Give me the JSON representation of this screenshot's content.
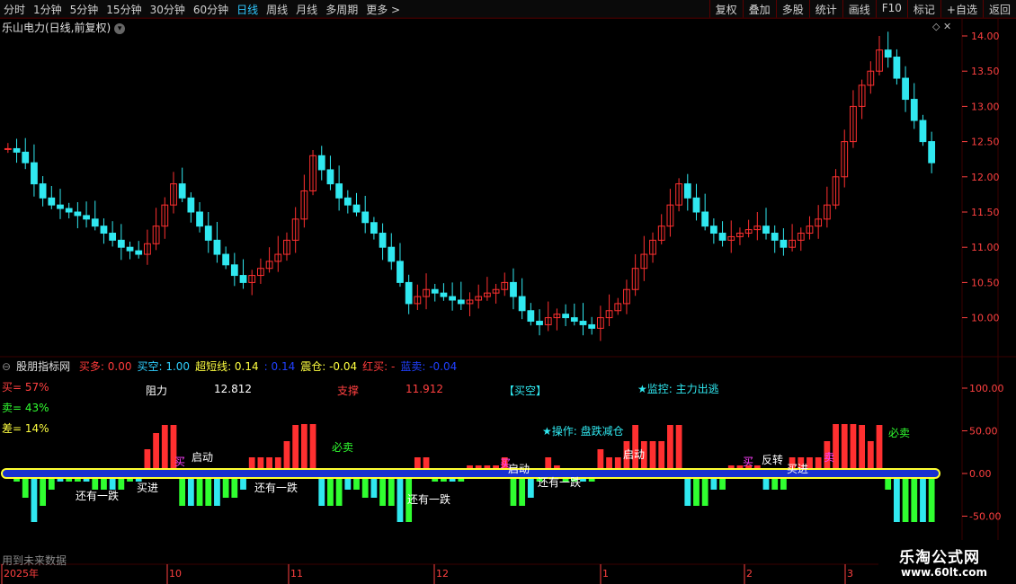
{
  "toolbar": {
    "periods": [
      "分时",
      "1分钟",
      "5分钟",
      "15分钟",
      "30分钟",
      "60分钟",
      "日线",
      "周线",
      "月线",
      "多周期",
      "更多 >"
    ],
    "active_period": "日线",
    "actions": [
      "复权",
      "叠加",
      "多股",
      "统计",
      "画线",
      "F10",
      "标记",
      "+自选",
      "返回"
    ]
  },
  "stock": {
    "title": "乐山电力(日线,前复权)"
  },
  "price_axis": {
    "ticks": [
      "14.00",
      "13.50",
      "13.00",
      "12.50",
      "12.00",
      "11.50",
      "11.00",
      "10.50",
      "10.00"
    ]
  },
  "indicator": {
    "name": "股朋指标网",
    "fields": [
      {
        "label": "买多: 0.00",
        "color": "#ff3b3b"
      },
      {
        "label": "买空: 1.00",
        "color": "#30d0ff"
      },
      {
        "label": "超短线: 0.14",
        "color": "#ffff40"
      },
      {
        "label": ": 0.14",
        "color": "#2040ff"
      },
      {
        "label": "震仓: -0.04",
        "color": "#ffff40"
      },
      {
        "label": "红买: -",
        "color": "#ff3b3b"
      },
      {
        "label": "蓝卖: -0.04",
        "color": "#2040ff"
      }
    ],
    "axis_ticks": [
      "100.00",
      "50.00",
      "0.00",
      "-50.00"
    ],
    "stats": {
      "buy": "买= 57%",
      "sell": "卖= 43%",
      "diff": "差= 14%"
    },
    "resistance_label": "阻力",
    "resistance_value": "12.812",
    "support_label": "支撑",
    "support_value": "11.912",
    "status": "【买空】",
    "monitor": "★监控: 主力出逃",
    "operation": "★操作: 盘跌减仓",
    "annotations": [
      "启动",
      "启动",
      "启动",
      "还有一跌",
      "还有一跌",
      "还有一跌",
      "还有一跌",
      "必卖",
      "必卖",
      "反转",
      "买",
      "买",
      "卖",
      "买",
      "买进",
      "买进"
    ],
    "footer_note": "用到未来数据"
  },
  "time_axis": {
    "labels": [
      "2025年",
      "10",
      "11",
      "12",
      "1",
      "2",
      "3"
    ]
  },
  "watermark": {
    "line1": "乐淘公式网",
    "line2": "www.60lt.com"
  },
  "colors": {
    "up": "#ff3030",
    "down": "#30e8f0",
    "grid": "#3a0000",
    "axis_text": "#ff4040"
  }
}
